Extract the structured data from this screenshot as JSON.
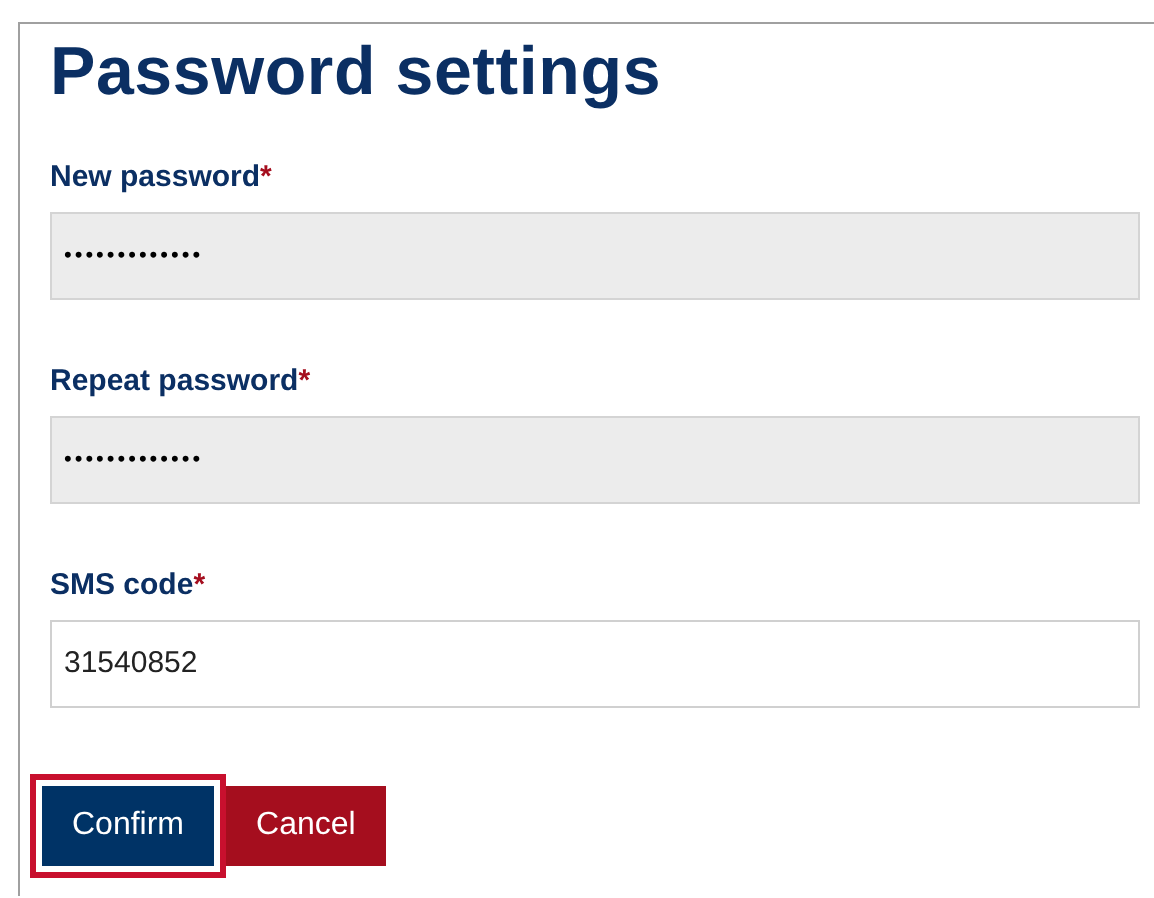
{
  "title": "Password settings",
  "fields": [
    {
      "label": "New password",
      "required_mark": "*",
      "kind": "password",
      "value": "•••••••••••••"
    },
    {
      "label": "Repeat password",
      "required_mark": "*",
      "kind": "password",
      "value": "•••••••••••••"
    },
    {
      "label": "SMS code",
      "required_mark": "*",
      "kind": "text",
      "value": "31540852"
    }
  ],
  "buttons": [
    {
      "label": "Confirm",
      "kind": "primary",
      "focused": true
    },
    {
      "label": "Cancel",
      "kind": "danger",
      "focused": false
    }
  ]
}
